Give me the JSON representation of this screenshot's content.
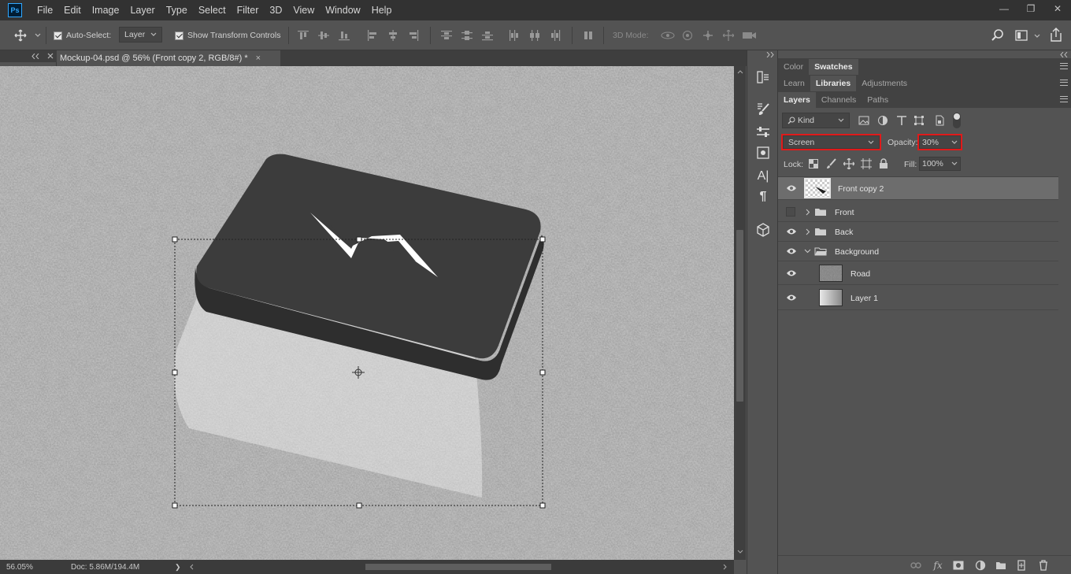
{
  "app": {
    "logo": "Ps"
  },
  "menu": [
    "File",
    "Edit",
    "Image",
    "Layer",
    "Type",
    "Select",
    "Filter",
    "3D",
    "View",
    "Window",
    "Help"
  ],
  "window_controls": {
    "minimize": "—",
    "restore": "❐",
    "close": "✕"
  },
  "options": {
    "auto_select_label": "Auto-Select:",
    "auto_select_value": "Layer",
    "transform_label": "Show Transform Controls",
    "mode_3d_label": "3D Mode:"
  },
  "document": {
    "tab_title": "Mockup-04.psd @ 56% (Front copy 2, RGB/8#) *",
    "tab_close": "×"
  },
  "status": {
    "zoom": "56.05%",
    "doc": "Doc: 5.86M/194.4M",
    "arrow": "❯"
  },
  "panels": {
    "row1_tabs": [
      "Color",
      "Swatches"
    ],
    "row1_active": "Swatches",
    "row2_tabs": [
      "Learn",
      "Libraries",
      "Adjustments"
    ],
    "row2_active": "Libraries",
    "row3_tabs": [
      "Layers",
      "Channels",
      "Paths"
    ],
    "row3_active": "Layers"
  },
  "layers_panel": {
    "filter_value": "Kind",
    "blend_mode": "Screen",
    "opacity_label": "Opacity:",
    "opacity_value": "30%",
    "lock_label": "Lock:",
    "fill_label": "Fill:",
    "fill_value": "100%",
    "layers": [
      {
        "name": "Front copy 2",
        "visible": true,
        "selected": true,
        "kind": "layer"
      },
      {
        "name": "Front",
        "visible": false,
        "selected": false,
        "kind": "group"
      },
      {
        "name": "Back",
        "visible": true,
        "selected": false,
        "kind": "group"
      },
      {
        "name": "Background",
        "visible": true,
        "selected": false,
        "kind": "group-open"
      },
      {
        "name": "Road",
        "visible": true,
        "selected": false,
        "kind": "child"
      },
      {
        "name": "Layer 1",
        "visible": true,
        "selected": false,
        "kind": "child"
      }
    ]
  },
  "colors": {
    "highlight_box": "#e11a1a",
    "foreground": "#ffffff",
    "background": "#000000"
  }
}
